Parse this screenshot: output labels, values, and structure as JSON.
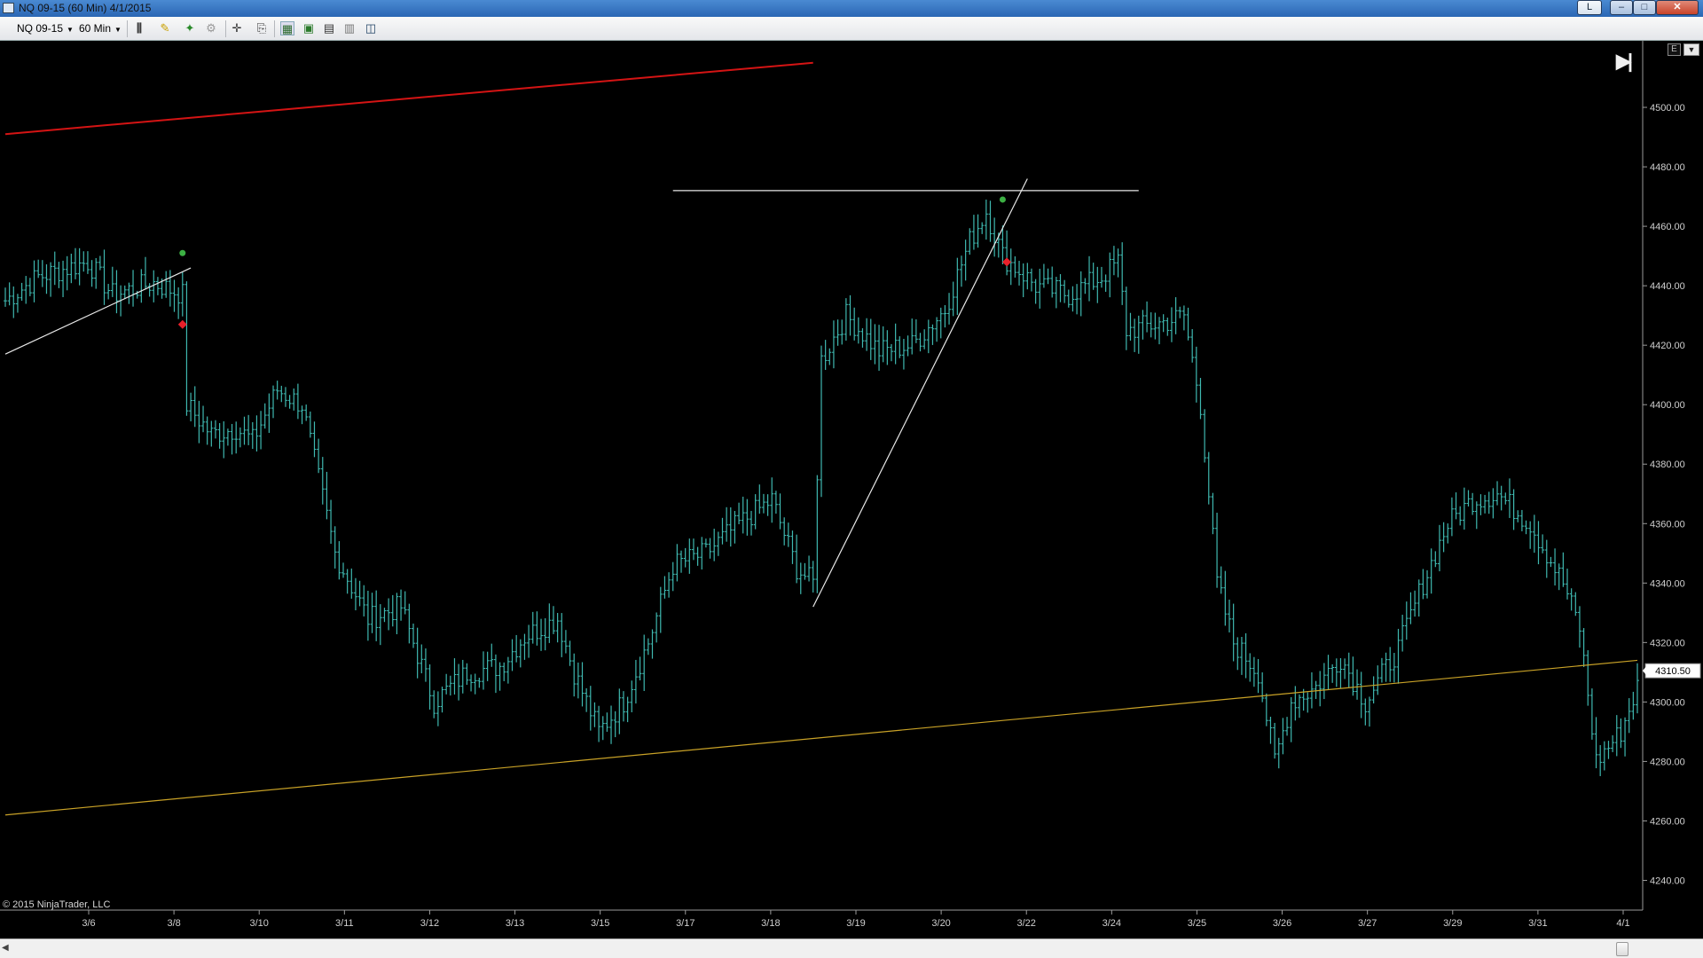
{
  "window": {
    "title": "NQ 09-15 (60 Min)  4/1/2015",
    "link_button": "L",
    "minimize_glyph": "–",
    "maximize_glyph": "□",
    "close_glyph": "✕"
  },
  "toolbar": {
    "instrument": "NQ 09-15",
    "interval": "60 Min",
    "icons": [
      "bar-style-icon",
      "drawing-tools-icon",
      "indicator-icon",
      "strategy-icon",
      "crosshair-icon",
      "data-box-icon",
      "chart-trader-icon",
      "properties-icon",
      "template-icon",
      "share-icon",
      "window-icon"
    ]
  },
  "chart": {
    "copyright": "© 2015 NinjaTrader, LLC",
    "last_price": "4310.50",
    "panel_button": "E",
    "colors": {
      "bars": "#3fb8b0",
      "trendline_red": "#d41414",
      "trendline_gold": "#c9a227",
      "trendline_white": "#e8e8e8",
      "marker_green": "#3cb043",
      "marker_red": "#e8202a",
      "axis": "#9a9a9a",
      "background": "#000000"
    }
  },
  "chart_data": {
    "type": "ohlc",
    "instrument": "NQ 09-15",
    "interval": "60 Min",
    "y_ticks": [
      "4500.00",
      "4480.00",
      "4460.00",
      "4440.00",
      "4420.00",
      "4400.00",
      "4380.00",
      "4360.00",
      "4340.00",
      "4320.00",
      "4300.00",
      "4280.00",
      "4260.00",
      "4240.00"
    ],
    "ylim": [
      4230,
      4520
    ],
    "x_ticks": [
      "3/6",
      "3/8",
      "3/10",
      "3/11",
      "3/12",
      "3/13",
      "3/15",
      "3/17",
      "3/18",
      "3/19",
      "3/20",
      "3/22",
      "3/24",
      "3/25",
      "3/26",
      "3/27",
      "3/29",
      "3/31",
      "4/1"
    ],
    "price_path": [
      [
        0,
        4435
      ],
      [
        8,
        4443
      ],
      [
        20,
        4448
      ],
      [
        26,
        4437
      ],
      [
        36,
        4441
      ],
      [
        43,
        4437
      ],
      [
        44,
        4400
      ],
      [
        50,
        4390
      ],
      [
        56,
        4392
      ],
      [
        60,
        4388
      ],
      [
        66,
        4405
      ],
      [
        72,
        4400
      ],
      [
        80,
        4350
      ],
      [
        88,
        4328
      ],
      [
        96,
        4332
      ],
      [
        104,
        4300
      ],
      [
        112,
        4310
      ],
      [
        120,
        4312
      ],
      [
        126,
        4322
      ],
      [
        134,
        4328
      ],
      [
        138,
        4310
      ],
      [
        144,
        4290
      ],
      [
        150,
        4300
      ],
      [
        156,
        4320
      ],
      [
        162,
        4346
      ],
      [
        170,
        4350
      ],
      [
        178,
        4360
      ],
      [
        186,
        4368
      ],
      [
        192,
        4345
      ],
      [
        196,
        4340
      ],
      [
        198,
        4415
      ],
      [
        204,
        4430
      ],
      [
        212,
        4418
      ],
      [
        220,
        4420
      ],
      [
        228,
        4432
      ],
      [
        234,
        4455
      ],
      [
        238,
        4465
      ],
      [
        242,
        4450
      ],
      [
        250,
        4440
      ],
      [
        258,
        4437
      ],
      [
        266,
        4443
      ],
      [
        270,
        4448
      ],
      [
        272,
        4425
      ],
      [
        282,
        4428
      ],
      [
        286,
        4430
      ],
      [
        290,
        4400
      ],
      [
        294,
        4340
      ],
      [
        298,
        4320
      ],
      [
        304,
        4310
      ],
      [
        308,
        4280
      ],
      [
        312,
        4300
      ],
      [
        318,
        4305
      ],
      [
        324,
        4315
      ],
      [
        330,
        4300
      ],
      [
        338,
        4318
      ],
      [
        344,
        4340
      ],
      [
        350,
        4360
      ],
      [
        356,
        4368
      ],
      [
        362,
        4370
      ],
      [
        370,
        4360
      ],
      [
        378,
        4340
      ],
      [
        382,
        4325
      ],
      [
        386,
        4280
      ],
      [
        392,
        4290
      ],
      [
        396,
        4305
      ]
    ],
    "markers": [
      {
        "type": "dot",
        "color": "green",
        "bar": 43,
        "price": 4451
      },
      {
        "type": "diamond",
        "color": "red",
        "bar": 43,
        "price": 4427
      },
      {
        "type": "dot",
        "color": "green",
        "bar": 242,
        "price": 4469
      },
      {
        "type": "diamond",
        "color": "red",
        "bar": 243,
        "price": 4448
      }
    ],
    "trendlines": [
      {
        "color": "red",
        "from": [
          0,
          4491
        ],
        "to": [
          196,
          4515
        ]
      },
      {
        "color": "gold",
        "from": [
          0,
          4262
        ],
        "to": [
          396,
          4314
        ]
      },
      {
        "color": "white",
        "from": [
          0,
          4417
        ],
        "to": [
          45,
          4446
        ]
      },
      {
        "color": "white",
        "from": [
          162,
          4472
        ],
        "to": [
          275,
          4472
        ]
      },
      {
        "color": "white",
        "from": [
          196,
          4332
        ],
        "to": [
          248,
          4476
        ]
      }
    ],
    "last_price": 4310.5
  }
}
